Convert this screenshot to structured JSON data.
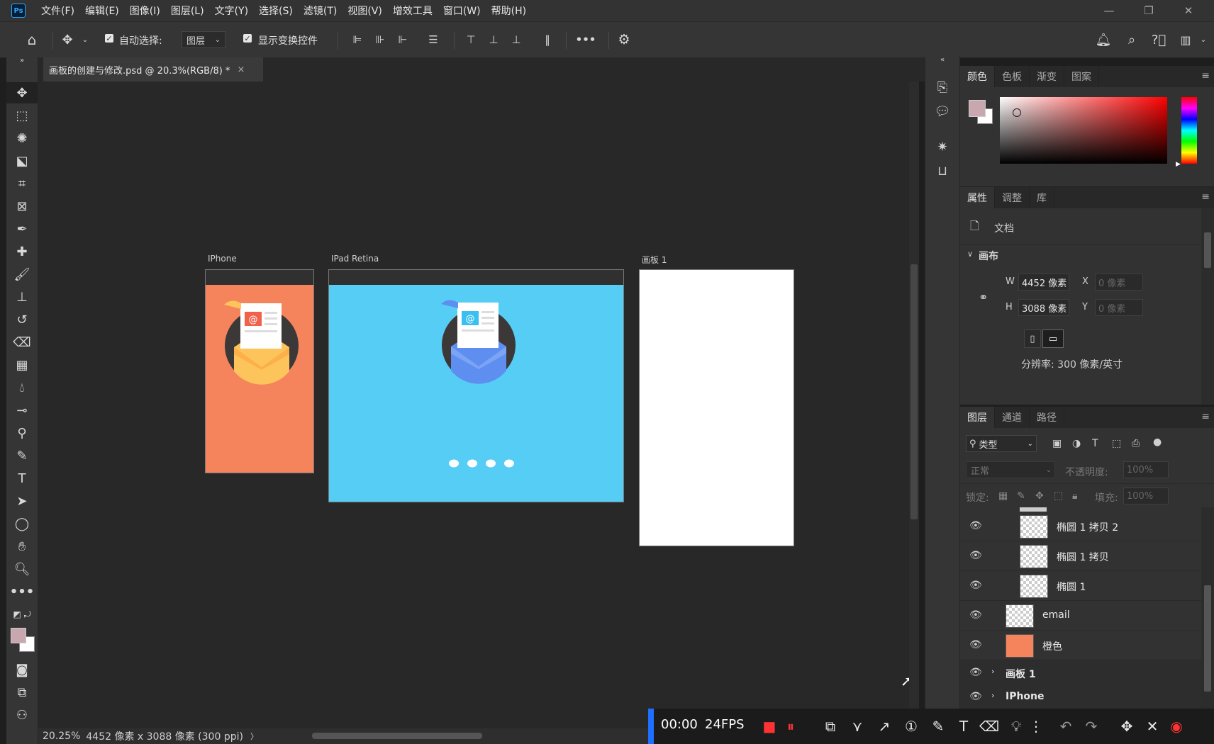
{
  "app": {
    "logo": "Ps"
  },
  "menubar": {
    "items": [
      "文件(F)",
      "编辑(E)",
      "图像(I)",
      "图层(L)",
      "文字(Y)",
      "选择(S)",
      "滤镜(T)",
      "视图(V)",
      "增效工具",
      "窗口(W)",
      "帮助(H)"
    ]
  },
  "options": {
    "auto_select_label": "自动选择:",
    "auto_select_value": "图层",
    "show_transform_label": "显示变换控件",
    "more": "•••"
  },
  "document": {
    "tab_title": "画板的创建与修改.psd @ 20.3%(RGB/8) *",
    "close": "×"
  },
  "artboards": [
    {
      "label": "IPhone",
      "color": "#f5845c"
    },
    {
      "label": "IPad Retina",
      "color": "#55cdf5"
    },
    {
      "label": "画板 1",
      "color": "#ffffff"
    }
  ],
  "status": {
    "zoom": "20.25%",
    "doc_info": "4452 像素 x 3088 像素 (300 ppi)",
    "arrow": "〉"
  },
  "color_panel": {
    "tabs": [
      "颜色",
      "色板",
      "渐变",
      "图案"
    ],
    "foreground": "#c8a8ae",
    "background": "#ffffff"
  },
  "properties_panel": {
    "tabs": [
      "属性",
      "调整",
      "库"
    ],
    "doc_label": "文档",
    "canvas_section": "画布",
    "w_label": "W",
    "w_value": "4452 像素",
    "h_label": "H",
    "h_value": "3088 像素",
    "x_label": "X",
    "x_value": "0 像素",
    "y_label": "Y",
    "y_value": "0 像素",
    "resolution": "分辨率: 300 像素/英寸"
  },
  "layers_panel": {
    "tabs": [
      "图层",
      "通道",
      "路径"
    ],
    "filter_label": "类型",
    "blend_mode": "正常",
    "opacity_label": "不透明度:",
    "opacity_value": "100%",
    "lock_label": "锁定:",
    "fill_label": "填充:",
    "fill_value": "100%",
    "layers": [
      {
        "name": "椭圆 1 拷贝 2",
        "type": "shape"
      },
      {
        "name": "椭圆 1 拷贝",
        "type": "shape"
      },
      {
        "name": "椭圆 1",
        "type": "shape"
      },
      {
        "name": "email",
        "type": "smart"
      },
      {
        "name": "橙色",
        "type": "smart"
      },
      {
        "name": "画板 1",
        "type": "group"
      },
      {
        "name": "IPhone",
        "type": "group"
      }
    ]
  },
  "recorder": {
    "time": "00:00",
    "fps": "24FPS"
  }
}
